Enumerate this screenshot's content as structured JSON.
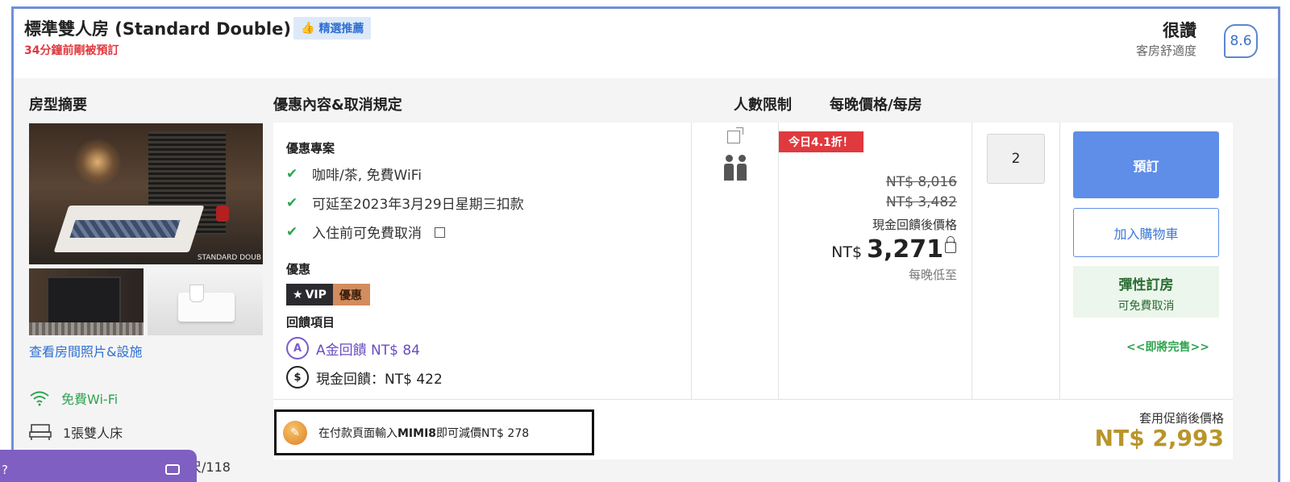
{
  "room": {
    "title": "標準雙人房 (Standard Double)",
    "recommended_badge": "精選推薦",
    "recent_booking": "34分鐘前剛被預訂",
    "rating_word": "很讚",
    "rating_subtitle": "客房舒適度",
    "rating_score": "8.6"
  },
  "columns": {
    "summary": "房型摘要",
    "offer": "優惠內容&取消規定",
    "occupancy": "人數限制",
    "price": "每晚價格/每房"
  },
  "summary": {
    "photo_label": "STANDARD DOUB",
    "view_photos_link": "查看房間照片&設施",
    "amenities": [
      {
        "icon": "wifi-icon",
        "label": "免費Wi-Fi"
      },
      {
        "icon": "bed-icon",
        "label": "1張雙人床"
      }
    ],
    "size_fragment": "尺/118"
  },
  "popup": {
    "text": "? ",
    "icon": "chat-icon"
  },
  "offer": {
    "package_title": "優惠專案",
    "items": [
      "咖啡/茶, 免費WiFi",
      "可延至2023年3月29日星期三扣款",
      "入住前可免費取消"
    ],
    "discount_title": "優惠",
    "vip_label": "VIP",
    "vip_discount": "優惠",
    "rewards_title": "回饋項目",
    "reward_a": "A金回饋 NT$ 84",
    "reward_cash": "現金回饋：NT$ 422"
  },
  "price": {
    "discount_tag": "今日4.1折！",
    "original_1": "NT$ 8,016",
    "original_2": "NT$ 3,482",
    "after_cashback_label": "現金回饋後價格",
    "currency": "NT$",
    "amount": "3,271",
    "per_night_note": "每晚低至"
  },
  "quantity": "2",
  "actions": {
    "book": "預訂",
    "add_to_cart": "加入購物車",
    "flex_title": "彈性訂房",
    "flex_sub": "可免費取消",
    "selling_out": "<<即將完售>>"
  },
  "promo": {
    "prefix": "在付款頁面輸入",
    "code": "MIMI8",
    "suffix": "即可減價NT$ 278",
    "after_label": "套用促銷後價格",
    "after_price": "NT$ 2,993"
  },
  "colors": {
    "accent_blue": "#5f8ee8",
    "alert_red": "#e0393e",
    "success_green": "#2ea44f",
    "promo_gold": "#b9952a",
    "popup_purple": "#7f5fc2"
  }
}
